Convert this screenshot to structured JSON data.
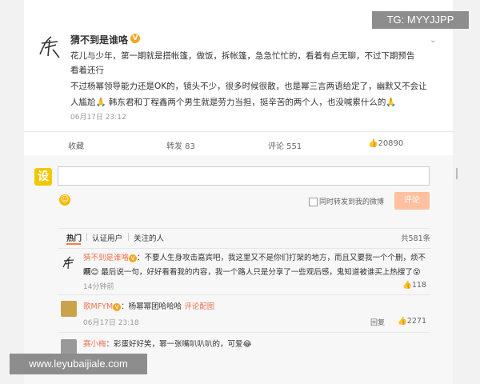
{
  "watermarks": {
    "tg": "TG: MYYJJPP",
    "site": "www.leyubaijiale.com"
  },
  "post": {
    "author": "猜不到是谁咯",
    "verified_badge": "V",
    "lines": [
      "花儿与少年，第一期就是搭帐篷，做饭，拆帐篷，急急忙忙的，看着有点无聊，不过下期预告",
      "看着还行",
      "不过杨幂领导能力还是OK的，镜头不少，很多时候很散，也是幂三言两语给定了，幽默又不会让",
      "人尴尬🙏 韩东君和丁程鑫两个男生就是劳力当担，挺辛苦的两个人，也没喊累什么的🙏"
    ],
    "time": "06月17日 23:12",
    "actions": {
      "favorite": "收藏",
      "repost": "转发 83",
      "comment": "评论 551",
      "like": "20890"
    }
  },
  "composer": {
    "logo": "设",
    "repost_label": "同时转发到我的微博",
    "submit_label": "评论"
  },
  "tabs": {
    "items": [
      "热门",
      "认证用户",
      "关注的人"
    ],
    "count": "共581条"
  },
  "comments": [
    {
      "name": "猜不到是谁咯",
      "text_line1": "：不要人生身攻击嘉宾吧，我这里又不是你们打架的地方，而且又要我一个个删，烦不烦",
      "text_line2": "啊😊 最后说一句，好好看看我的内容，我一个路人只是分享了一些观后感，鬼知道被谁买上热搜了😵",
      "time": "14分钟前",
      "like": "118",
      "reply": ""
    },
    {
      "name": "歌MFYM",
      "text": "：杨幂幂团哈哈哈",
      "extra_link": "评论配图",
      "time": "06月17日 23:18",
      "reply": "回复",
      "like": "2271"
    },
    {
      "name": "赛小梅",
      "text": "：彩蛋好好笑，幂一张嘴叭叭叭的，可爱😂"
    }
  ],
  "icons": {
    "accent": "#eb7350",
    "badge": "#f5a623"
  }
}
